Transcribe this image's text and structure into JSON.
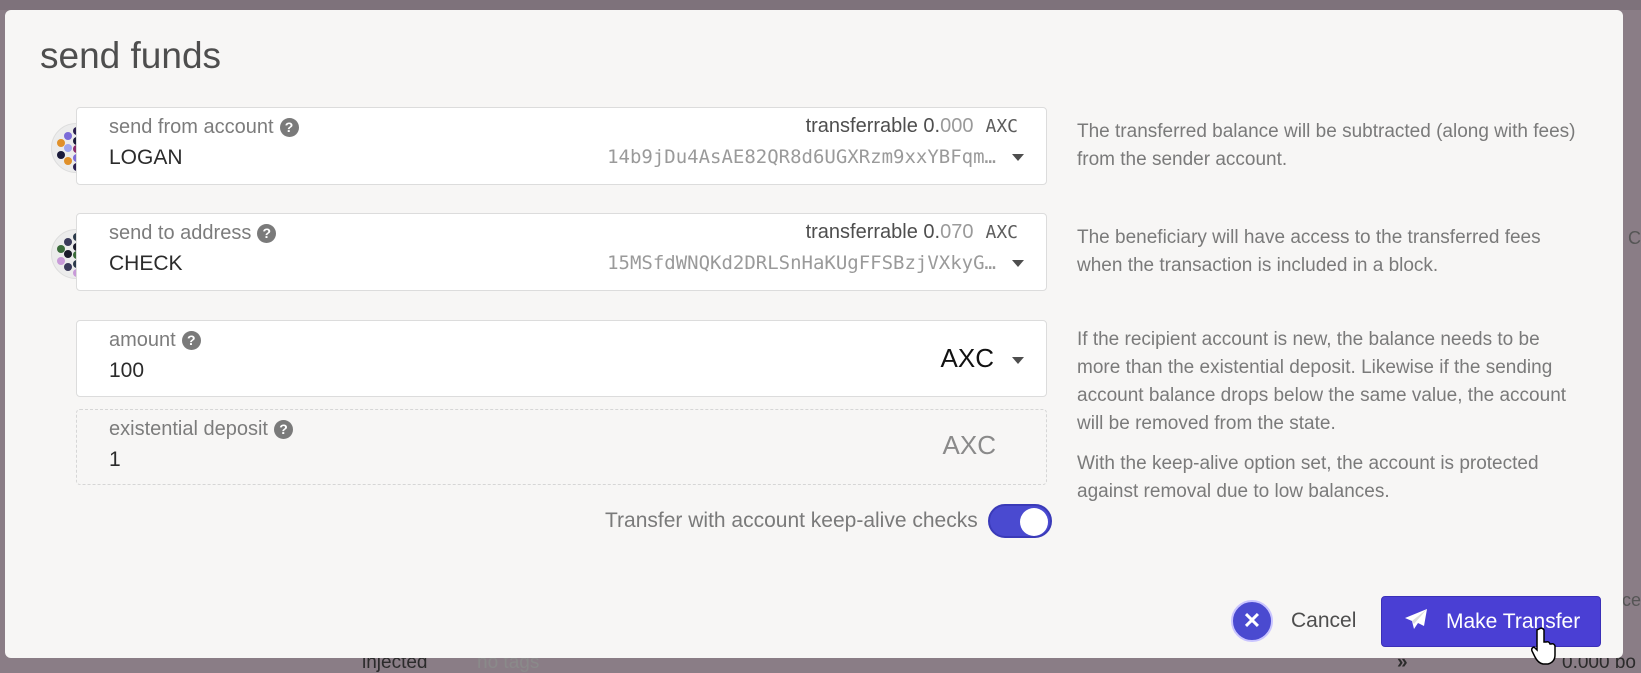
{
  "modal": {
    "title": "send funds"
  },
  "from": {
    "label": "send from account",
    "name": "LOGAN",
    "transferrable_label": "transferrable",
    "balance_int": "0.",
    "balance_dec": "000",
    "unit": "AXC",
    "address": "14b9jDu4AsAE82QR8d6UGXRzm9xxYBFqm…",
    "help": "The transferred balance will be subtracted (along with fees) from the sender account."
  },
  "to": {
    "label": "send to address",
    "name": "CHECK",
    "transferrable_label": "transferrable",
    "balance_int": "0.",
    "balance_dec": "070",
    "unit": "AXC",
    "address": "15MSfdWNQKd2DRLSnHaKUgFFSBzjVXkyG…",
    "help": "The beneficiary will have access to the transferred fees when the transaction is included in a block."
  },
  "amount": {
    "label": "amount",
    "value": "100",
    "unit": "AXC",
    "help": "If the recipient account is new, the balance needs to be more than the existential deposit. Likewise if the sending account balance drops below the same value, the account will be removed from the state."
  },
  "deposit": {
    "label": "existential deposit",
    "value": "1",
    "unit": "AXC"
  },
  "keepalive": {
    "label": "Transfer with account keep-alive checks",
    "enabled": true,
    "help": "With the keep-alive option set, the account is protected against removal due to low balances."
  },
  "actions": {
    "cancel": "Cancel",
    "submit": "Make Transfer"
  },
  "background": {
    "row_type": "injected",
    "row_tags": "no tags",
    "row_balance": "0.000 bo",
    "side_text_1": "a C",
    "side_text_2": "ace"
  },
  "colors": {
    "accent": "#4a3fd4",
    "modal_bg": "#f7f6f5"
  },
  "icons": [
    "help-icon",
    "chevron-down-icon",
    "close-icon",
    "send-icon",
    "hand-cursor-icon",
    "identicon"
  ]
}
